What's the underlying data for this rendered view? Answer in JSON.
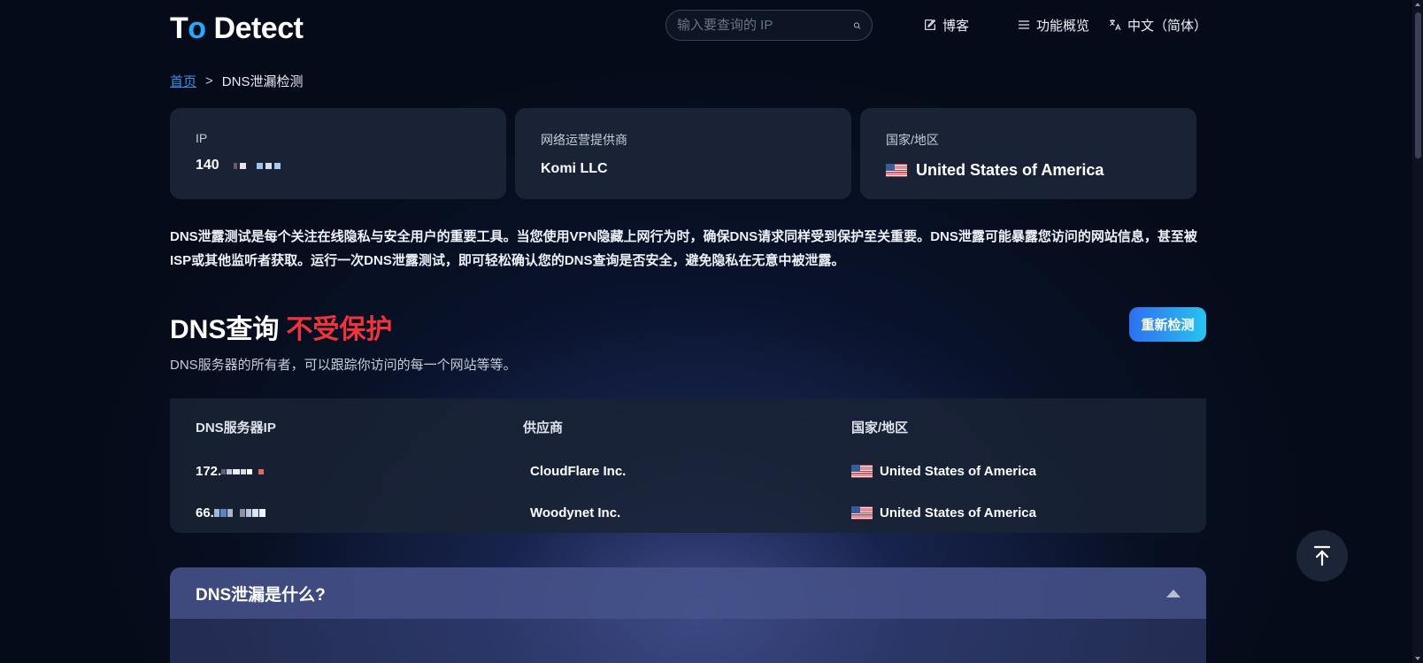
{
  "header": {
    "logo": {
      "part1": "T",
      "part2": "o",
      "part3": " Detect"
    },
    "search_placeholder": "输入要查询的 IP",
    "nav": {
      "blog": "博客",
      "features": "功能概览",
      "language": "中文（简体）"
    }
  },
  "breadcrumb": {
    "home": "首页",
    "separator": ">",
    "current": "DNS泄漏检测"
  },
  "cards": [
    {
      "label": "IP",
      "value": "140"
    },
    {
      "label": "网络运营提供商",
      "value": "Komi LLC"
    },
    {
      "label": "国家/地区",
      "value": "United States of America"
    }
  ],
  "description": "DNS泄露测试是每个关注在线隐私与安全用户的重要工具。当您使用VPN隐藏上网行为时，确保DNS请求同样受到保护至关重要。DNS泄露可能暴露您访问的网站信息，甚至被ISP或其他监听者获取。运行一次DNS泄露测试，即可轻松确认您的DNS查询是否安全，避免隐私在无意中被泄露。",
  "status": {
    "title": "DNS查询",
    "state": "不受保护",
    "subtitle": "DNS服务器的所有者，可以跟踪你访问的每一个网站等等。",
    "recheck_label": "重新检测"
  },
  "table": {
    "headers": [
      "DNS服务器IP",
      "供应商",
      "国家/地区"
    ],
    "rows": [
      {
        "ip": "172.",
        "provider": "CloudFlare Inc.",
        "country": "United States of America"
      },
      {
        "ip": "66.",
        "provider": "Woodynet Inc.",
        "country": "United States of America"
      }
    ]
  },
  "accordion": {
    "title": "DNS泄漏是什么?"
  },
  "colors": {
    "accent": "#27a9ff",
    "danger": "#f0343c",
    "card_bg": "#1a2335",
    "button_from": "#2f6ff0",
    "button_to": "#27c3f0"
  },
  "icons": {
    "search": "search-icon",
    "blog": "edit-icon",
    "features": "menu-icon",
    "language": "translate-icon",
    "back_to_top": "arrow-up-to-line-icon",
    "accordion_toggle": "caret-up-icon"
  }
}
